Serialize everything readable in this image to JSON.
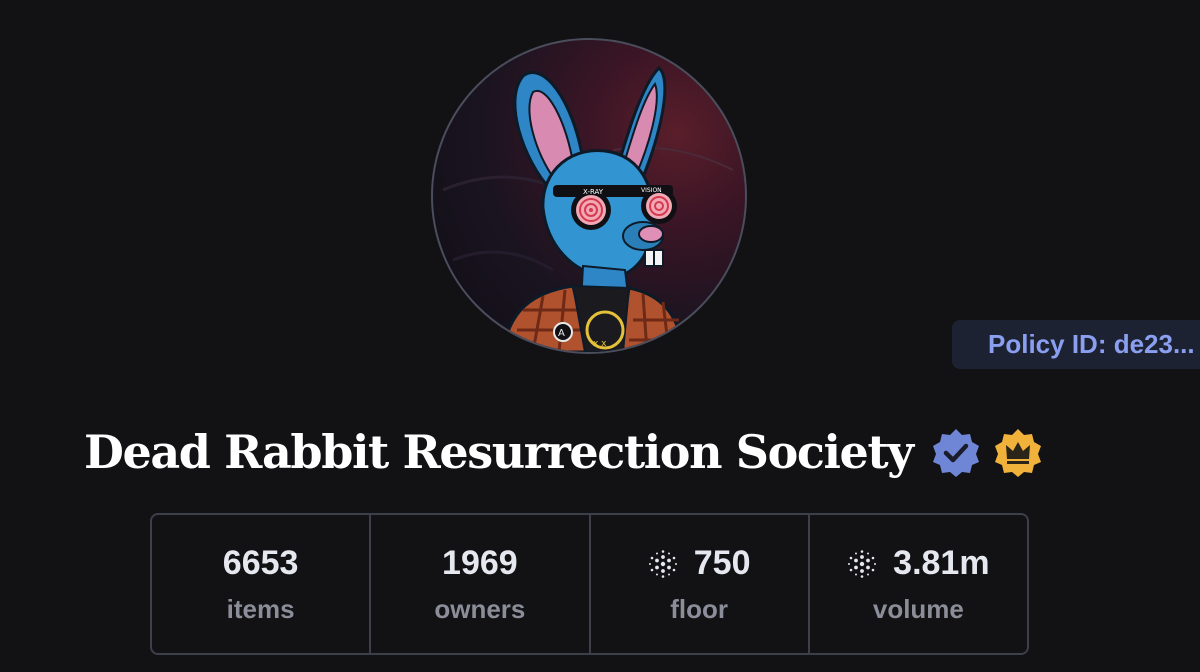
{
  "collection": {
    "name": "Dead Rabbit Resurrection Society",
    "policy_id_label": "Policy ID: de23...",
    "badges": [
      "verified-badge-icon",
      "crown-badge-icon"
    ]
  },
  "avatar": {
    "icon": "rabbit-avatar-image",
    "text_left_lens": "X-RAY",
    "text_right_lens": "VISION"
  },
  "stats": [
    {
      "value": "6653",
      "label": "items",
      "icon": null
    },
    {
      "value": "1969",
      "label": "owners",
      "icon": null
    },
    {
      "value": "750",
      "label": "floor",
      "icon": "cardano-ada-icon"
    },
    {
      "value": "3.81m",
      "label": "volume",
      "icon": "cardano-ada-icon"
    }
  ],
  "colors": {
    "background": "#121114",
    "policy_chip_bg": "#1d2233",
    "policy_chip_text": "#8a9ff0",
    "verified_badge": "#6f86d6",
    "crown_badge": "#f0b23a",
    "stat_border": "#3d3f4a",
    "stat_label": "#8b8d98"
  }
}
